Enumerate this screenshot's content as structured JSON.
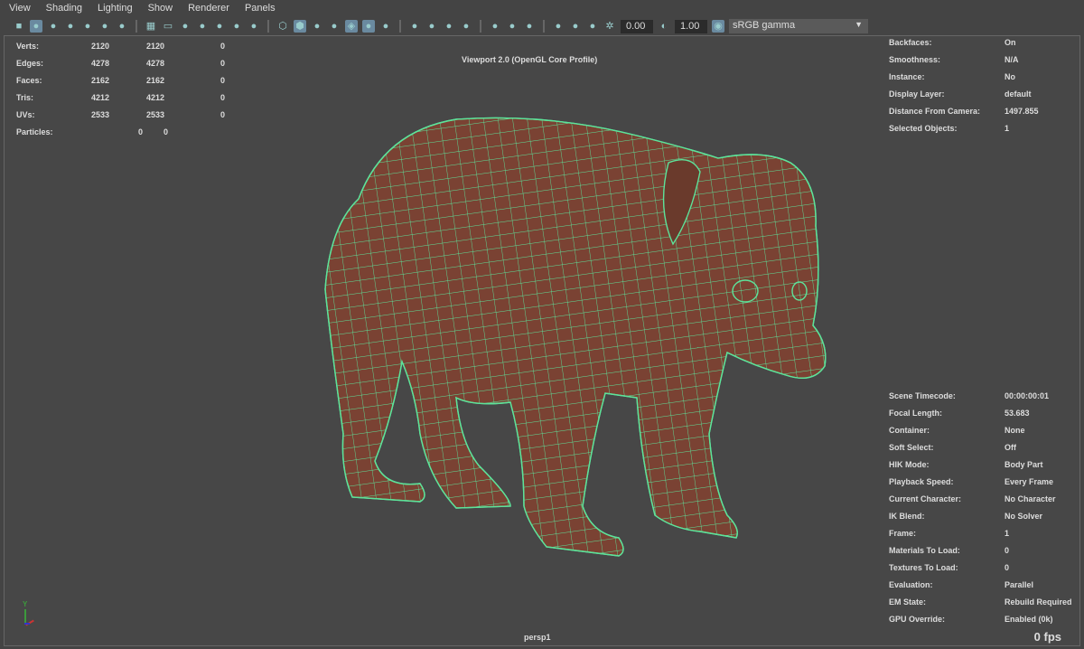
{
  "menu": [
    "View",
    "Shading",
    "Lighting",
    "Show",
    "Renderer",
    "Panels"
  ],
  "toolbar": {
    "exposure": "0.00",
    "gamma": "1.00",
    "color_space": "sRGB gamma",
    "icons": [
      "camera",
      "camera-lock",
      "camera-attributes",
      "bookmark",
      "image-plane",
      "2d-pan",
      "grease-pencil",
      "grid",
      "film-gate",
      "resolution-gate",
      "gate-mask",
      "field-chart",
      "safe-action",
      "safe-title",
      "wireframe",
      "smooth-shade",
      "default-material",
      "wireframe-on-shaded",
      "textured",
      "use-all-lights",
      "shadows",
      "xray",
      "xray-joints",
      "xray-components",
      "isolate-select",
      "select-camera",
      "backface",
      "screen-space-ao",
      "motion-blur",
      "multisample",
      "depth-of-field",
      "exposure",
      "gamma",
      "view-transform"
    ]
  },
  "viewport": {
    "title": "Viewport 2.0 (OpenGL Core Profile)",
    "camera": "persp1",
    "fps": "0 fps"
  },
  "poly_stats": [
    {
      "label": "Verts:",
      "a": "2120",
      "b": "2120",
      "c": "0"
    },
    {
      "label": "Edges:",
      "a": "4278",
      "b": "4278",
      "c": "0"
    },
    {
      "label": "Faces:",
      "a": "2162",
      "b": "2162",
      "c": "0"
    },
    {
      "label": "Tris:",
      "a": "4212",
      "b": "4212",
      "c": "0"
    },
    {
      "label": "UVs:",
      "a": "2533",
      "b": "2533",
      "c": "0"
    }
  ],
  "particles": {
    "label": "Particles:",
    "a": "0",
    "b": "0"
  },
  "hud_right_top": [
    {
      "label": "Backfaces:",
      "value": "On"
    },
    {
      "label": "Smoothness:",
      "value": "N/A"
    },
    {
      "label": "Instance:",
      "value": "No"
    },
    {
      "label": "Display Layer:",
      "value": "default"
    },
    {
      "label": "Distance From Camera:",
      "value": "1497.855"
    },
    {
      "label": "Selected Objects:",
      "value": "1"
    }
  ],
  "hud_right_bottom": [
    {
      "label": "Scene Timecode:",
      "value": "00:00:00:01"
    },
    {
      "label": "Focal Length:",
      "value": "53.683"
    },
    {
      "label": "Container:",
      "value": "None"
    },
    {
      "label": "Soft Select:",
      "value": "Off"
    },
    {
      "label": "HIK Mode:",
      "value": "Body Part"
    },
    {
      "label": "Playback Speed:",
      "value": "Every Frame"
    },
    {
      "label": "Current Character:",
      "value": "No Character"
    },
    {
      "label": "IK Blend:",
      "value": "No Solver"
    },
    {
      "label": "Frame:",
      "value": "1"
    },
    {
      "label": "Materials To Load:",
      "value": "0"
    },
    {
      "label": "Textures To Load:",
      "value": "0"
    },
    {
      "label": "Evaluation:",
      "value": "Parallel"
    },
    {
      "label": "EM State:",
      "value": "Rebuild Required"
    },
    {
      "label": "GPU Override:",
      "value": "Enabled (0k)"
    }
  ],
  "axis_label": "Y",
  "colors": {
    "wire": "#5de39a",
    "mesh": "#7a4233",
    "bg": "#474747"
  }
}
